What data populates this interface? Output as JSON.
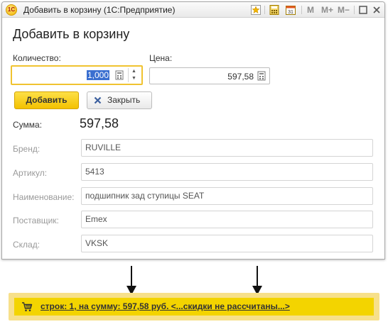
{
  "window": {
    "title": "Добавить в корзину  (1С:Предприятие)",
    "toolbar": {
      "m_label": "M",
      "m_plus_label": "M+",
      "m_minus_label": "M−"
    }
  },
  "form": {
    "title": "Добавить в корзину",
    "quantity": {
      "label": "Количество:",
      "value": "1,000"
    },
    "price": {
      "label": "Цена:",
      "value": "597,58"
    },
    "buttons": {
      "add_label": "Добавить",
      "close_label": "Закрыть"
    },
    "sum": {
      "label": "Сумма:",
      "value": "597,58"
    },
    "fields": [
      {
        "label": "Бренд:",
        "value": "RUVILLE"
      },
      {
        "label": "Артикул:",
        "value": "5413"
      },
      {
        "label": "Наименование:",
        "value": "подшипник зад ступицы SEAT"
      },
      {
        "label": "Поставщик:",
        "value": "Emex"
      },
      {
        "label": "Склад:",
        "value": "VKSK"
      }
    ]
  },
  "status_bar": {
    "text": "строк: 1, на сумму: 597,58 руб. <...скидки не рассчитаны...>",
    "icon": "cart-icon"
  },
  "colors": {
    "accent_yellow": "#f3d400",
    "focus_border": "#f0c330",
    "selection_blue": "#3a6fd0"
  }
}
